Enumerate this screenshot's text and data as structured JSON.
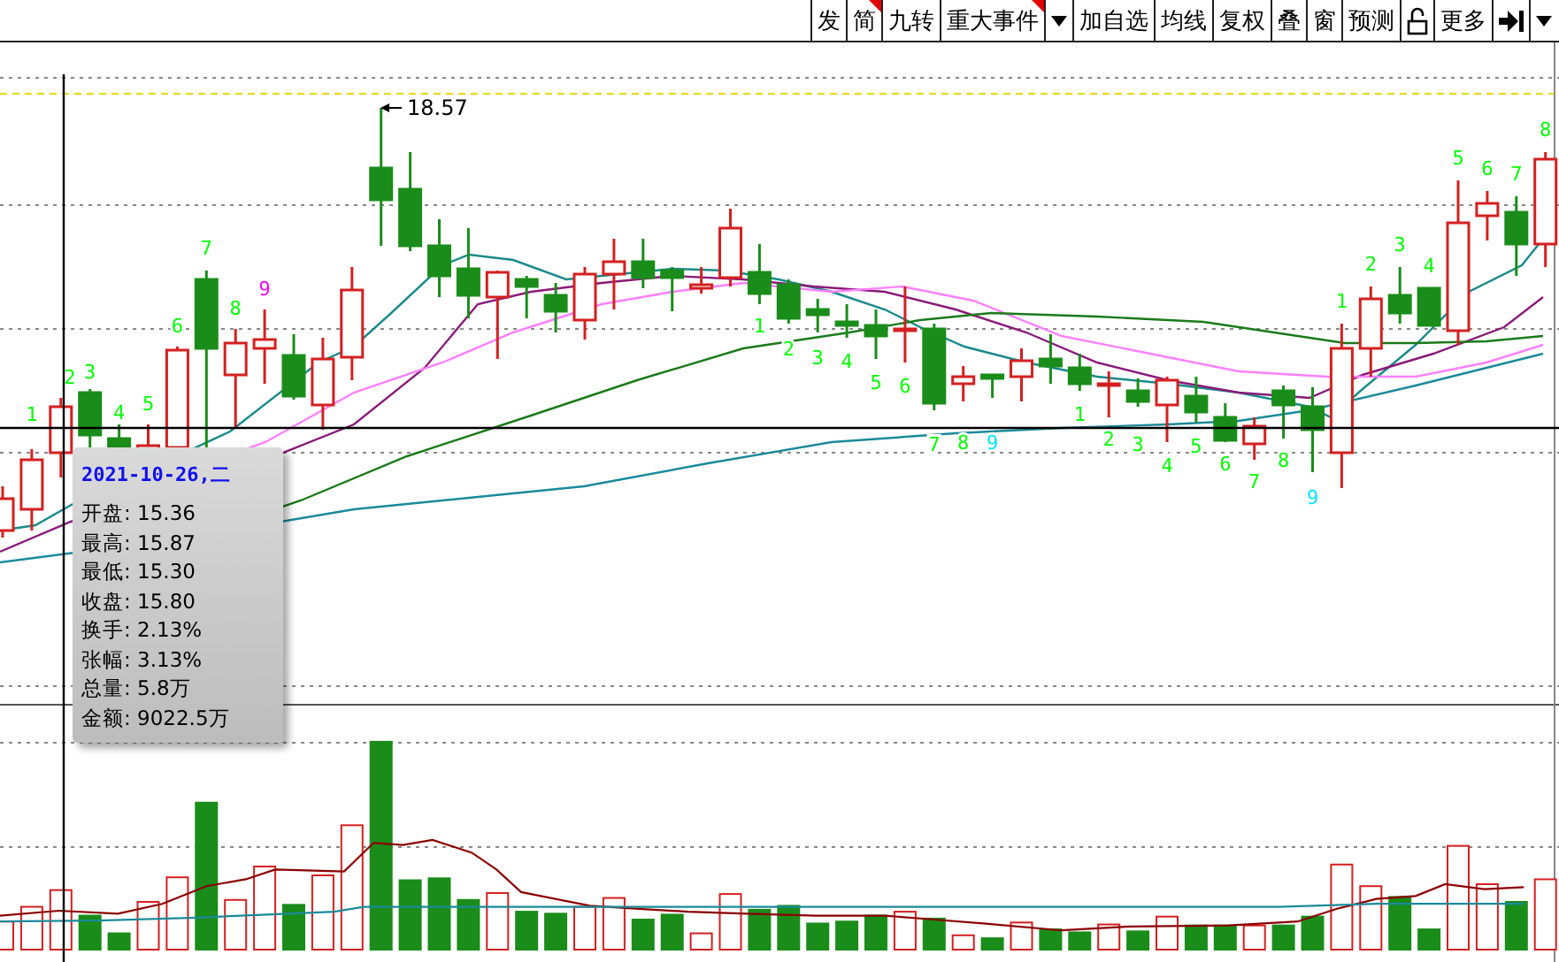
{
  "toolbar": {
    "items": [
      {
        "kind": "text",
        "label": "发",
        "marked": false
      },
      {
        "kind": "text",
        "label": "简",
        "marked": true
      },
      {
        "kind": "text",
        "label": "九转",
        "marked": false
      },
      {
        "kind": "text",
        "label": "重大事件",
        "marked": true
      },
      {
        "kind": "caret"
      },
      {
        "kind": "text",
        "label": "加自选",
        "marked": false
      },
      {
        "kind": "text",
        "label": "均线",
        "marked": false
      },
      {
        "kind": "text",
        "label": "复权",
        "marked": false
      },
      {
        "kind": "text",
        "label": "叠",
        "marked": false
      },
      {
        "kind": "text",
        "label": "窗",
        "marked": false
      },
      {
        "kind": "text",
        "label": "预测",
        "marked": false
      },
      {
        "kind": "lock"
      },
      {
        "kind": "text",
        "label": "更多",
        "marked": false
      },
      {
        "kind": "end"
      },
      {
        "kind": "caret"
      }
    ]
  },
  "chart": {
    "high_label": "18.57",
    "td_marks": [
      {
        "text": "1",
        "color": "#00ff00"
      },
      {
        "text": "2",
        "color": "#00ff00"
      },
      {
        "text": "3",
        "color": "#00ff00"
      },
      {
        "text": "4",
        "color": "#00ff00"
      },
      {
        "text": "5",
        "color": "#00ff00"
      },
      {
        "text": "6",
        "color": "#00ff00"
      },
      {
        "text": "7",
        "color": "#00ff00"
      },
      {
        "text": "8",
        "color": "#00ff00"
      },
      {
        "text": "9",
        "color": "#ff00ff"
      },
      {
        "text": "1",
        "color": "#00ff00"
      },
      {
        "text": "2",
        "color": "#00ff00"
      },
      {
        "text": "3",
        "color": "#00ff00"
      },
      {
        "text": "4",
        "color": "#00ff00"
      },
      {
        "text": "5",
        "color": "#00ff00"
      },
      {
        "text": "6",
        "color": "#00ff00"
      },
      {
        "text": "7",
        "color": "#00ff00"
      },
      {
        "text": "8",
        "color": "#00ff00"
      },
      {
        "text": "9",
        "color": "#00e5ff"
      },
      {
        "text": "1",
        "color": "#00ff00"
      },
      {
        "text": "2",
        "color": "#00ff00"
      },
      {
        "text": "3",
        "color": "#00ff00"
      },
      {
        "text": "4",
        "color": "#00ff00"
      },
      {
        "text": "5",
        "color": "#00ff00"
      },
      {
        "text": "6",
        "color": "#00ff00"
      },
      {
        "text": "7",
        "color": "#00ff00"
      },
      {
        "text": "8",
        "color": "#00ff00"
      },
      {
        "text": "9",
        "color": "#00e5ff"
      },
      {
        "text": "1",
        "color": "#00ff00"
      },
      {
        "text": "2",
        "color": "#00ff00"
      },
      {
        "text": "3",
        "color": "#00ff00"
      },
      {
        "text": "4",
        "color": "#00ff00"
      },
      {
        "text": "5",
        "color": "#00ff00"
      },
      {
        "text": "6",
        "color": "#00ff00"
      },
      {
        "text": "7",
        "color": "#00ff00"
      },
      {
        "text": "8",
        "color": "#00ff00"
      }
    ]
  },
  "tooltip": {
    "date": "2021-10-26,二",
    "rows": [
      "开盘: 15.36",
      "最高: 15.87",
      "最低: 15.30",
      "收盘: 15.80",
      "换手: 2.13%",
      "张幅: 3.13%",
      "总量: 5.8万",
      "金额: 9022.5万"
    ]
  }
}
